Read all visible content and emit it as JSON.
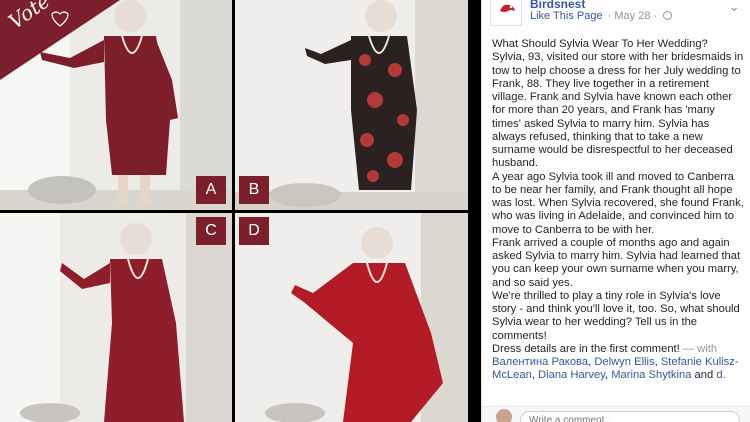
{
  "photo": {
    "banner_text": "Vote",
    "options": [
      "A",
      "B",
      "C",
      "D"
    ]
  },
  "post": {
    "page_name": "Birdsnest",
    "like_link": "Like This Page",
    "date": "· May 28 ·",
    "options_icon": "ellipsis-icon",
    "globe_icon": "globe-icon",
    "paragraphs": [
      "What Should Sylvia Wear To Her Wedding?",
      "Sylvia, 93, visited our store with her bridesmaids in tow to help choose a dress for her July wedding to Frank, 88. They live together in a retirement village. Frank and Sylvia have known each other for more than 20 years, and Frank has 'many times' asked Sylvia to marry him. Sylvia has always refused, thinking that to take a new surname would be disrespectful to her deceased husband.",
      "A year ago Sylvia took ill and moved to Canberra to be near her family, and Frank thought all hope was lost. When Sylvia recovered, she found Frank, who was living in Adelaide, and convinced him to move to Canberra to be with her.",
      "Frank arrived a couple of months ago and again asked Sylvia to marry him. Sylvia had learned that you can keep your own surname when you marry, and so said yes.",
      "We're thrilled to play a tiny role in Sylvia's love story - and think you'll love it, too. So, what should Sylvia wear to her wedding? Tell us in the comments!"
    ],
    "last_line": "Dress details are in the first comment!",
    "with_text": " — with ",
    "tagged": [
      "Валентина Ракова",
      "Delwyn Ellis",
      "Stefanie Kulisz-McLean",
      "Diana Harvey",
      "Marina Shytkina"
    ],
    "and_text": " and ",
    "and_more": "d.",
    "comment_placeholder": "Write a comment..."
  },
  "colors": {
    "brand": "#7a1f2b",
    "link": "#365899",
    "text": "#1d2129",
    "meta": "#90949c"
  }
}
